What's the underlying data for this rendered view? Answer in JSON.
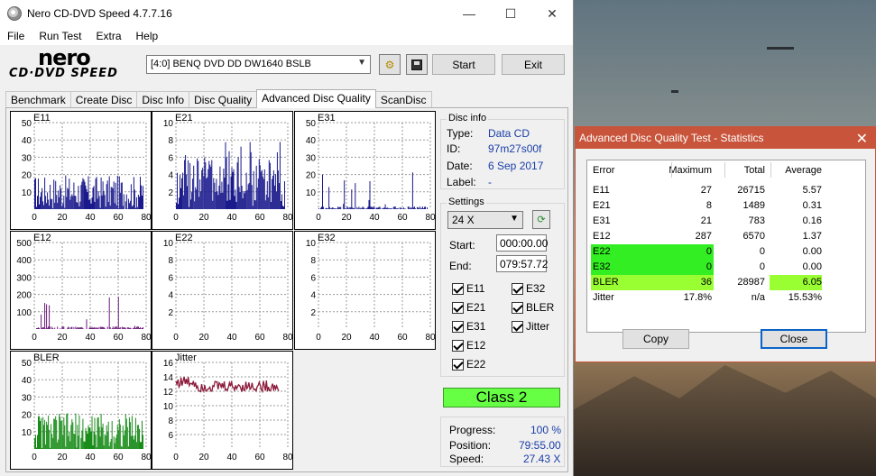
{
  "window": {
    "title": "Nero CD-DVD Speed 4.7.7.16",
    "minimize_glyph": "—",
    "maximize_glyph": "☐",
    "close_glyph": "✕"
  },
  "menu": [
    "File",
    "Run Test",
    "Extra",
    "Help"
  ],
  "logo": {
    "brand": "nero",
    "product": "CD·DVD SPEED"
  },
  "toolbar": {
    "drive": "[4:0]   BENQ DVD DD DW1640 BSLB",
    "start_label": "Start",
    "exit_label": "Exit",
    "icons": [
      "tool-icon",
      "save-icon"
    ]
  },
  "tabs": [
    "Benchmark",
    "Create Disc",
    "Disc Info",
    "Disc Quality",
    "Advanced Disc Quality",
    "ScanDisc"
  ],
  "active_tab": "Advanced Disc Quality",
  "graphs": [
    {
      "label": "E11",
      "yticks": [
        "50",
        "40",
        "30",
        "20",
        "10"
      ],
      "color": "#1a1a8c",
      "max": 50,
      "level": 0.3
    },
    {
      "label": "E21",
      "yticks": [
        "10",
        "8",
        "6",
        "4",
        "2"
      ],
      "color": "#1a1a8c",
      "max": 10,
      "level": 0.45
    },
    {
      "label": "E31",
      "yticks": [
        "50",
        "40",
        "30",
        "20",
        "10"
      ],
      "color": "#1a1a8c",
      "max": 50,
      "level": 0.06
    },
    {
      "label": "E12",
      "yticks": [
        "500",
        "400",
        "300",
        "200",
        "100"
      ],
      "color": "#6a1a7a",
      "max": 500,
      "level": 0.05
    },
    {
      "label": "E22",
      "yticks": [
        "10",
        "8",
        "6",
        "4",
        "2"
      ],
      "color": "#1a1a8c",
      "max": 10,
      "level": 0
    },
    {
      "label": "E32",
      "yticks": [
        "10",
        "8",
        "6",
        "4",
        "2"
      ],
      "color": "#1a1a8c",
      "max": 10,
      "level": 0
    },
    {
      "label": "BLER",
      "yticks": [
        "50",
        "40",
        "30",
        "20",
        "10"
      ],
      "color": "#1a8c1a",
      "max": 50,
      "level": 0.32
    },
    {
      "label": "Jitter",
      "yticks": [
        "16",
        "14",
        "12",
        "10",
        "8",
        "6"
      ],
      "color": "#8c1a3a",
      "max": 16,
      "level": 0
    }
  ],
  "xticks": [
    "0",
    "20",
    "40",
    "60",
    "80"
  ],
  "disc_info": {
    "title": "Disc info",
    "type_label": "Type:",
    "type": "Data CD",
    "id_label": "ID:",
    "id": "97m27s00f",
    "date_label": "Date:",
    "date": "6 Sep 2017",
    "label_label": "Label:",
    "label": "-"
  },
  "settings": {
    "title": "Settings",
    "speed": "24 X",
    "start_label": "Start:",
    "start": "000:00.00",
    "end_label": "End:",
    "end": "079:57.72",
    "checks": {
      "e11": "E11",
      "e32": "E32",
      "e21": "E21",
      "bler": "BLER",
      "e31": "E31",
      "jitter": "Jitter",
      "e12": "E12",
      "e22": "E22"
    }
  },
  "class_label": "Class 2",
  "progress": {
    "progress_label": "Progress:",
    "progress": "100 %",
    "position_label": "Position:",
    "position": "79:55.00",
    "speed_label": "Speed:",
    "speed": "27.43 X"
  },
  "dialog": {
    "title": "Advanced Disc Quality Test - Statistics",
    "headers": [
      "Error",
      "Maximum",
      "Total",
      "Average"
    ],
    "rows": [
      [
        "E11",
        "27",
        "26715",
        "5.57"
      ],
      [
        "E21",
        "8",
        "1489",
        "0.31"
      ],
      [
        "E31",
        "21",
        "783",
        "0.16"
      ],
      [
        "E12",
        "287",
        "6570",
        "1.37"
      ],
      [
        "E22",
        "0",
        "0",
        "0.00"
      ],
      [
        "E32",
        "0",
        "0",
        "0.00"
      ],
      [
        "BLER",
        "36",
        "28987",
        "6.05"
      ],
      [
        "Jitter",
        "17.8%",
        "n/a",
        "15.53%"
      ]
    ],
    "copy_label": "Copy",
    "close_label": "Close",
    "highlight_color": "#33ee22",
    "avg_highlight_color": "#99ff33"
  }
}
